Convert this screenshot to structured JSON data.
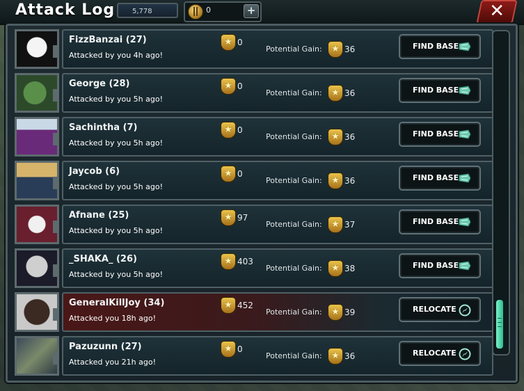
{
  "window": {
    "title": "Attack Log"
  },
  "resources": {
    "primary_value": "5,778",
    "coins_value": "0"
  },
  "colors": {
    "accent": "#2dbb90",
    "enemy_row": "#4a1717",
    "gold": "#e9c34a"
  },
  "rows": [
    {
      "name": "FizzBanzai (27)",
      "subtitle": "Attacked by you 4h ago!",
      "trophies": "0",
      "gain_label": "Potential Gain:",
      "gain": "36",
      "action": "FIND BASE",
      "action_icon": "radar-icon",
      "enemy": false
    },
    {
      "name": "George (28)",
      "subtitle": "Attacked by you 5h ago!",
      "trophies": "0",
      "gain_label": "Potential Gain:",
      "gain": "36",
      "action": "FIND BASE",
      "action_icon": "radar-icon",
      "enemy": false
    },
    {
      "name": "Sachintha (7)",
      "subtitle": "Attacked by you 5h ago!",
      "trophies": "0",
      "gain_label": "Potential Gain:",
      "gain": "36",
      "action": "FIND BASE",
      "action_icon": "radar-icon",
      "enemy": false
    },
    {
      "name": "Jaycob (6)",
      "subtitle": "Attacked by you 5h ago!",
      "trophies": "0",
      "gain_label": "Potential Gain:",
      "gain": "36",
      "action": "FIND BASE",
      "action_icon": "radar-icon",
      "enemy": false
    },
    {
      "name": "Afnane (25)",
      "subtitle": "Attacked by you 5h ago!",
      "trophies": "97",
      "gain_label": "Potential Gain:",
      "gain": "37",
      "action": "FIND BASE",
      "action_icon": "radar-icon",
      "enemy": false
    },
    {
      "name": "_SHAKA_ (26)",
      "subtitle": "Attacked by you 5h ago!",
      "trophies": "403",
      "gain_label": "Potential Gain:",
      "gain": "38",
      "action": "FIND BASE",
      "action_icon": "radar-icon",
      "enemy": false
    },
    {
      "name": "GeneralKillJoy (34)",
      "subtitle": "Attacked you 18h ago!",
      "trophies": "452",
      "gain_label": "Potential Gain:",
      "gain": "39",
      "action": "RELOCATE",
      "action_icon": "compass-icon",
      "enemy": true
    },
    {
      "name": "Pazuzunn (27)",
      "subtitle": "Attacked you 21h ago!",
      "trophies": "0",
      "gain_label": "Potential Gain:",
      "gain": "36",
      "action": "RELOCATE",
      "action_icon": "compass-icon",
      "enemy": false
    }
  ]
}
